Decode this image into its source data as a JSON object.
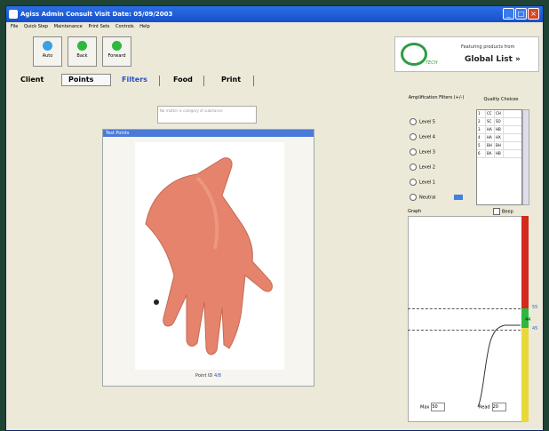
{
  "window": {
    "title": "Agiss  Admin  Consult     Visit Date: 05/09/2003",
    "controls": [
      "minimize",
      "maximize",
      "close"
    ]
  },
  "menu": [
    "File",
    "Quick Step",
    "Maintenance",
    "Print Sets",
    "Controls",
    "Help"
  ],
  "toolbar": [
    {
      "label": "Auto",
      "icon": "auto-icon",
      "color": "#3aa0e0"
    },
    {
      "label": "Back",
      "icon": "back-icon",
      "color": "#2fb83f"
    },
    {
      "label": "Forward",
      "icon": "forward-icon",
      "color": "#2fb83f"
    }
  ],
  "brand": {
    "tech": "TECH",
    "featuring": "Featuring products from",
    "list": "Global List »"
  },
  "tabs": [
    "Client",
    "Points",
    "Filters",
    "Food",
    "Print"
  ],
  "info_box": "No matter is category of substance",
  "panel": {
    "title": "Test Points",
    "point_label": "Point ID",
    "point_value": "4/8"
  },
  "amplification": {
    "title": "Amplification Filters (+/-)",
    "levels": [
      "Level 5",
      "Level 4",
      "Level 3",
      "Level 2",
      "Level 1",
      "Neutral"
    ]
  },
  "quality": {
    "title": "Quality Choices",
    "rows": [
      [
        "1",
        "CC",
        "CH"
      ],
      [
        "2",
        "SC",
        "SO"
      ],
      [
        "3",
        "HA",
        "HB"
      ],
      [
        "4",
        "HA",
        "HX"
      ],
      [
        "5",
        "BH",
        "BH"
      ],
      [
        "6",
        "BA",
        "HB"
      ]
    ]
  },
  "graph": {
    "label": "Graph",
    "beep": "Beep",
    "meter_values": [
      "55",
      "44",
      "45"
    ],
    "max_label": "Max",
    "max_value": "50",
    "read_label": "Read",
    "read_value": "20"
  }
}
